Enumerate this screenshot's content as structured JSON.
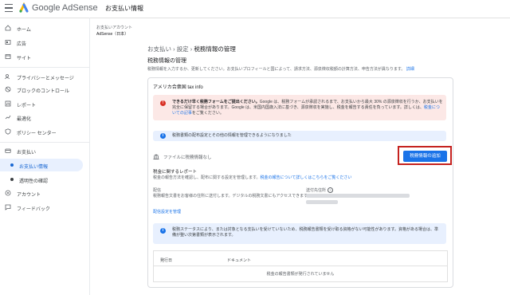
{
  "app": {
    "brand": "Google AdSense",
    "page_heading": "お支払い情報"
  },
  "sidebar": {
    "items": [
      {
        "label": "ホーム",
        "icon": "home-icon"
      },
      {
        "label": "広告",
        "icon": "ads-icon"
      },
      {
        "label": "サイト",
        "icon": "sites-icon"
      },
      {
        "label": "プライバシーとメッセージ",
        "icon": "privacy-icon"
      },
      {
        "label": "ブロックのコントロール",
        "icon": "block-icon"
      },
      {
        "label": "レポート",
        "icon": "reports-icon"
      },
      {
        "label": "最適化",
        "icon": "optimize-icon"
      },
      {
        "label": "ポリシー センター",
        "icon": "policy-icon"
      },
      {
        "label": "お支払い",
        "icon": "payments-icon"
      },
      {
        "label": "お支払い情報"
      },
      {
        "label": "透明性の確認"
      },
      {
        "label": "アカウント",
        "icon": "account-icon"
      },
      {
        "label": "フィードバック",
        "icon": "feedback-icon"
      }
    ]
  },
  "account": {
    "label": "お支払いアカウント",
    "name": "AdSense（日本）"
  },
  "breadcrumb": [
    "お支払い",
    "設定",
    "税務情報の管理"
  ],
  "main": {
    "section_title": "税務情報の管理",
    "description": "税務情報を入力するか、更新してください。お支払いプロフィールと国によって、請求方法、源泉徴収税額の計算方法、申告方法が異なります。",
    "description_link": "詳細",
    "card_title": "アメリカ合衆国 tax info",
    "alert_red_bold": "できるだけ早く税務フォームをご提出ください。",
    "alert_red_text": "Google は、税務フォームが承認されるまで、お支払いから最大 30% の源泉徴収を行うか、お支払いを完全に保留する場合があります。Google は、米国内国歳入法に基づき、源泉徴収を実施し、税金を報告する責任を負っています。詳しくは、",
    "alert_red_link": "税金についての記事",
    "alert_red_tail": "をご覧ください。",
    "alert_blue_1": "税務書類の配布設定とその他の情報を管理できるようになりました",
    "file_label": "ファイルに税務情報なし",
    "add_button": "税務情報の追加",
    "report_title": "税金に関するレポート",
    "report_desc": "税金の報告方法を確認し、配布に関する設定を管理します。",
    "report_link": "税金の報告について詳しくはこちらをご覧ください",
    "delivery_label": "配信",
    "delivery_desc": "税務報告文書をお客様の住所に送付します。デジタルの税務文書にもアクセスできます。",
    "sender_label": "送付先住所",
    "manage_link": "配信設定を管理",
    "alert_blue_2": "税務ステータスにより、または対象となる支払いを受けていないため、税務報告書類を受け取る資格がない可能性があります。資格がある場合は、準備が整い次第書類が表示されます。",
    "table_headers": [
      "発行日",
      "ドキュメント"
    ],
    "table_empty": "税金の報告書類が発行されていません"
  },
  "colors": {
    "accent": "#1a73e8",
    "selected_bg": "#e8f0fe",
    "error": "#d93025",
    "highlight_box": "#c5221f"
  }
}
